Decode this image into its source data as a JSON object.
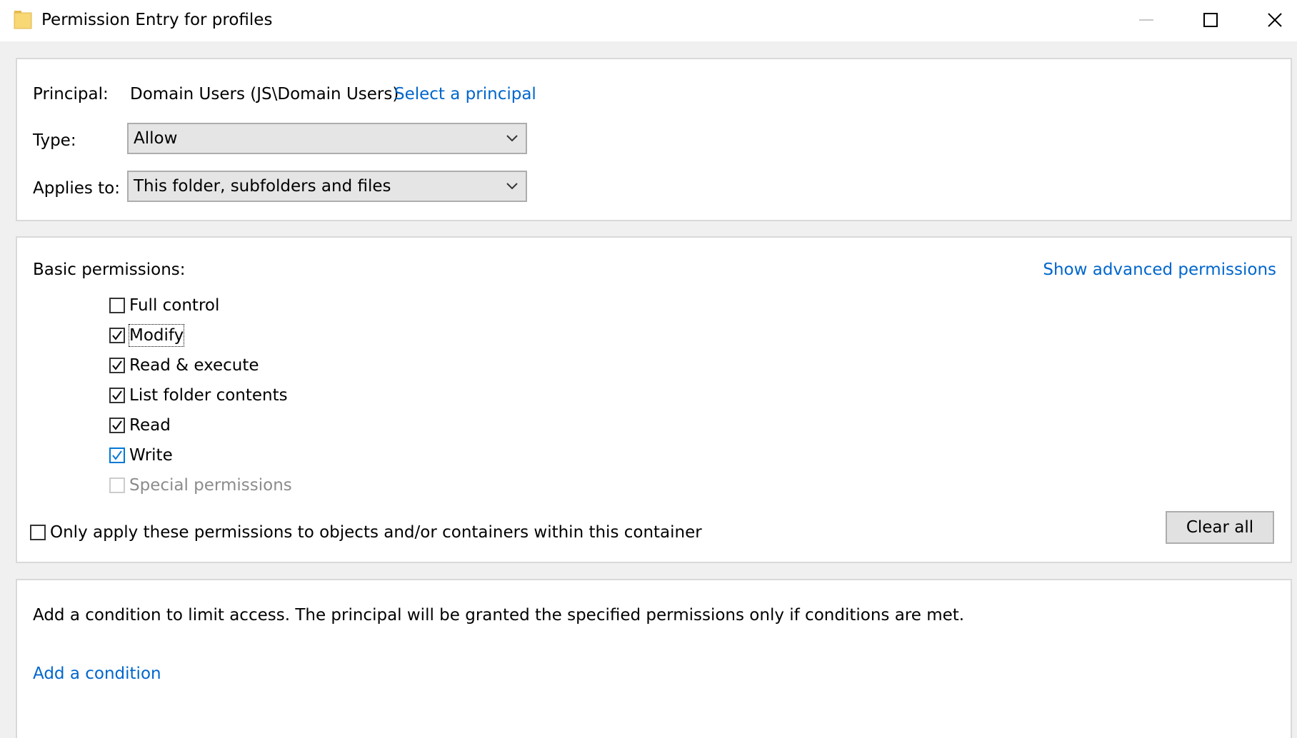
{
  "window": {
    "title": "Permission Entry for profiles",
    "icon": "folder-icon"
  },
  "principal_section": {
    "principal_label": "Principal:",
    "principal_value": "Domain Users (JS\\Domain Users)",
    "select_principal_link": "Select a principal",
    "type_label": "Type:",
    "type_value": "Allow",
    "applies_to_label": "Applies to:",
    "applies_to_value": "This folder, subfolders and files"
  },
  "permissions_section": {
    "basic_permissions_label": "Basic permissions:",
    "show_advanced_link": "Show advanced permissions",
    "items": [
      {
        "label": "Full control",
        "checked": false
      },
      {
        "label": "Modify",
        "checked": true
      },
      {
        "label": "Read & execute",
        "checked": true
      },
      {
        "label": "List folder contents",
        "checked": true
      },
      {
        "label": "Read",
        "checked": true
      },
      {
        "label": "Write",
        "checked": true
      },
      {
        "label": "Special permissions",
        "checked": false,
        "disabled": true
      }
    ],
    "only_apply_label": "Only apply these permissions to objects and/or containers within this container",
    "clear_all_button": "Clear all"
  },
  "condition_section": {
    "description": "Add a condition to limit access. The principal will be granted the specified permissions only if conditions are met.",
    "add_condition_link": "Add a condition"
  },
  "colors": {
    "link": "#0066cc",
    "checkbox_focus_blue": "#0078d7",
    "panel_border": "#d9d9d9",
    "dialog_background": "#f0f0f0"
  }
}
